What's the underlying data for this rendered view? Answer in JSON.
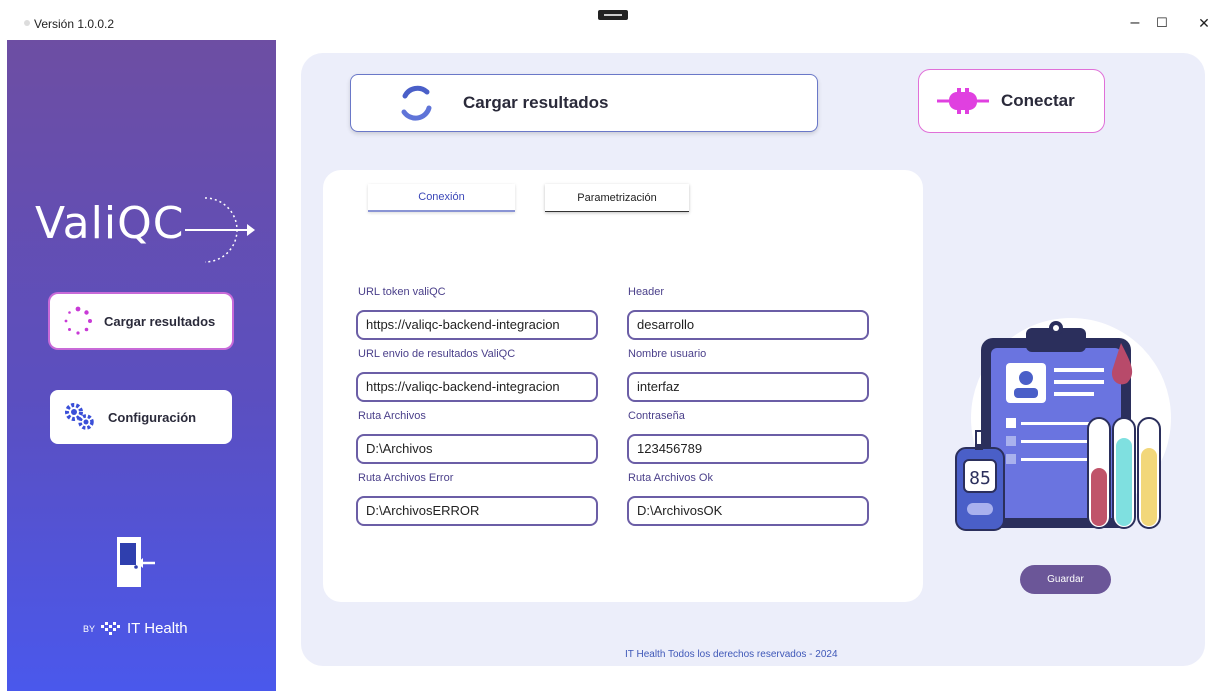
{
  "window": {
    "title": "Versión 1.0.0.2",
    "minimize": "–",
    "maximize": "☐",
    "close": "✕"
  },
  "sidebar": {
    "logo_text": "ValiQC",
    "buttons": [
      {
        "label": "Cargar resultados",
        "icon": "loading-icon"
      },
      {
        "label": "Configuración",
        "icon": "gears-icon"
      }
    ],
    "exit_icon": "exit-door-icon",
    "brand_by": "BY",
    "brand_name": "IT Health"
  },
  "top_buttons": {
    "cargar": "Cargar resultados",
    "conectar": "Conectar"
  },
  "tabs": [
    "Conexión",
    "Parametrización"
  ],
  "form": {
    "url_token_label": "URL token valiQC",
    "url_token_value": "https://valiqc-backend-integracion",
    "url_envio_label": "URL envio de resultados ValiQC",
    "url_envio_value": "https://valiqc-backend-integracion",
    "ruta_archivos_label": "Ruta Archivos",
    "ruta_archivos_value": "D:\\Archivos",
    "ruta_error_label": "Ruta Archivos Error",
    "ruta_error_value": "D:\\ArchivosERROR",
    "header_label": "Header",
    "header_value": "desarrollo",
    "usuario_label": "Nombre usuario",
    "usuario_value": "interfaz",
    "password_label": "Contraseña",
    "password_value": "123456789",
    "ruta_ok_label": "Ruta Archivos Ok",
    "ruta_ok_value": "D:\\ArchivosOK"
  },
  "illustration": {
    "glucometer_reading": "85"
  },
  "save_button": "Guardar",
  "footer": "IT Health Todos los derechos reservados - 2024",
  "colors": {
    "sidebar_top": "#6d4ea3",
    "sidebar_bottom": "#4a58ec",
    "accent_pink": "#e070d8",
    "save": "#6b5698",
    "field_border": "#6b5ea6"
  }
}
